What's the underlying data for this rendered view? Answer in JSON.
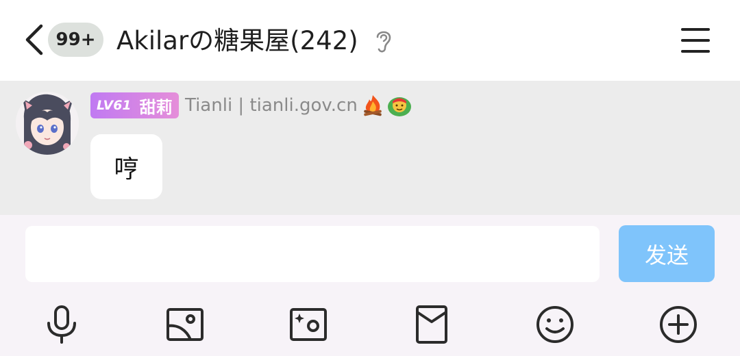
{
  "header": {
    "unread_badge": "99+",
    "title": "Akilarの糖果屋(242)"
  },
  "message": {
    "level": "LV61",
    "nickname": "甜莉",
    "sender_meta": "Tianli | tianli.gov.cn",
    "text": "哼",
    "emoji_icons": [
      "campfire-icon",
      "bandana-face-icon"
    ]
  },
  "composer": {
    "value": "",
    "send_label": "发送"
  },
  "toolbar": {
    "icons": [
      "microphone-icon",
      "image-icon",
      "camera-icon",
      "red-packet-icon",
      "emoji-icon",
      "plus-icon"
    ]
  },
  "colors": {
    "header_bg": "#ffffff",
    "message_area_bg": "#ececec",
    "send_button": "#7fc4fb",
    "level_tag_start": "#c07af2",
    "level_tag_end": "#e58ed9"
  }
}
